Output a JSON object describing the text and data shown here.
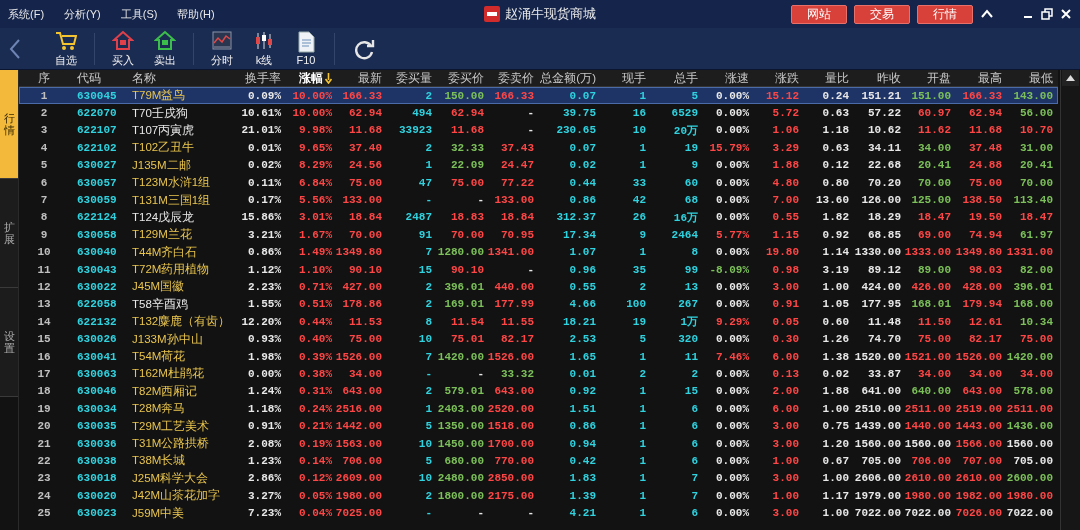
{
  "window": {
    "title": "赵涌牛现货商城",
    "menu": [
      "系统(F)",
      "分析(Y)",
      "工具(S)",
      "帮助(H)"
    ],
    "buttons": [
      "网站",
      "交易",
      "行情"
    ]
  },
  "toolbar": {
    "groups": [
      [
        {
          "kind": "cart",
          "label": "自选"
        }
      ],
      [
        {
          "kind": "buy",
          "label": "买入"
        },
        {
          "kind": "sell",
          "label": "卖出"
        }
      ],
      [
        {
          "kind": "intraday",
          "label": "分时"
        },
        {
          "kind": "kline",
          "label": "k线"
        },
        {
          "kind": "doc",
          "label": "F10"
        }
      ],
      [
        {
          "kind": "refresh"
        }
      ]
    ]
  },
  "side_tabs": [
    {
      "label": "行情",
      "selected": true
    },
    {
      "label": "扩展",
      "selected": false
    },
    {
      "label": "设置",
      "selected": false
    }
  ],
  "table": {
    "columns": [
      {
        "label": "序",
        "sorted": false
      },
      {
        "label": "代码",
        "sorted": false
      },
      {
        "label": "名称",
        "sorted": false
      },
      {
        "label": "换手率",
        "sorted": false
      },
      {
        "label": "涨幅",
        "sorted": true
      },
      {
        "label": "最新",
        "sorted": false
      },
      {
        "label": "委买量",
        "sorted": false
      },
      {
        "label": "委买价",
        "sorted": false
      },
      {
        "label": "委卖价",
        "sorted": false
      },
      {
        "label": "总金额(万)",
        "sorted": false
      },
      {
        "label": "现手",
        "sorted": false
      },
      {
        "label": "总手",
        "sorted": false
      },
      {
        "label": "涨速",
        "sorted": false
      },
      {
        "label": "涨跌",
        "sorted": false
      },
      {
        "label": "量比",
        "sorted": false
      },
      {
        "label": "昨收",
        "sorted": false
      },
      {
        "label": "开盘",
        "sorted": false
      },
      {
        "label": "最高",
        "sorted": false
      },
      {
        "label": "最低",
        "sorted": false
      }
    ],
    "rows": [
      {
        "selected": true,
        "highlight": true,
        "cells": [
          "1",
          "630045",
          "T79M益鸟",
          "0.09%",
          "10.00%",
          "166.33",
          "2",
          "150.00",
          "166.33",
          "0.07",
          "1",
          "5",
          "0.00%",
          "15.12",
          "0.24",
          "151.21",
          "151.00",
          "166.33",
          "143.00"
        ]
      },
      {
        "selected": false,
        "highlight": false,
        "cells": [
          "2",
          "622070",
          "T70壬戌狗",
          "10.61%",
          "10.00%",
          "62.94",
          "494",
          "62.94",
          "-",
          "39.75",
          "16",
          "6529",
          "0.00%",
          "5.72",
          "0.63",
          "57.22",
          "60.97",
          "62.94",
          "56.00"
        ]
      },
      {
        "selected": false,
        "highlight": false,
        "cells": [
          "3",
          "622107",
          "T107丙寅虎",
          "21.01%",
          "9.98%",
          "11.68",
          "33923",
          "11.68",
          "-",
          "230.65",
          "10",
          "20万",
          "0.00%",
          "1.06",
          "1.18",
          "10.62",
          "11.62",
          "11.68",
          "10.70"
        ]
      },
      {
        "selected": false,
        "highlight": true,
        "cells": [
          "4",
          "622102",
          "T102乙丑牛",
          "0.01%",
          "9.65%",
          "37.40",
          "2",
          "32.33",
          "37.43",
          "0.07",
          "1",
          "19",
          "15.79%",
          "3.29",
          "0.63",
          "34.11",
          "34.00",
          "37.48",
          "31.00"
        ]
      },
      {
        "selected": false,
        "highlight": true,
        "cells": [
          "5",
          "630027",
          "J135M二邮",
          "0.02%",
          "8.29%",
          "24.56",
          "1",
          "22.09",
          "24.47",
          "0.02",
          "1",
          "9",
          "0.00%",
          "1.88",
          "0.12",
          "22.68",
          "20.41",
          "24.88",
          "20.41"
        ]
      },
      {
        "selected": false,
        "highlight": true,
        "cells": [
          "6",
          "630057",
          "T123M水浒1组",
          "0.11%",
          "6.84%",
          "75.00",
          "47",
          "75.00",
          "77.22",
          "0.44",
          "33",
          "60",
          "0.00%",
          "4.80",
          "0.80",
          "70.20",
          "70.00",
          "75.00",
          "70.00"
        ]
      },
      {
        "selected": false,
        "highlight": true,
        "cells": [
          "7",
          "630059",
          "T131M三国1组",
          "0.17%",
          "5.56%",
          "133.00",
          "-",
          "-",
          "133.00",
          "0.86",
          "42",
          "68",
          "0.00%",
          "7.00",
          "13.60",
          "126.00",
          "125.00",
          "138.50",
          "113.40"
        ]
      },
      {
        "selected": false,
        "highlight": false,
        "cells": [
          "8",
          "622124",
          "T124戊辰龙",
          "15.86%",
          "3.01%",
          "18.84",
          "2487",
          "18.83",
          "18.84",
          "312.37",
          "26",
          "16万",
          "0.00%",
          "0.55",
          "1.82",
          "18.29",
          "18.47",
          "19.50",
          "18.47"
        ]
      },
      {
        "selected": false,
        "highlight": true,
        "cells": [
          "9",
          "630058",
          "T129M兰花",
          "3.21%",
          "1.67%",
          "70.00",
          "91",
          "70.00",
          "70.95",
          "17.34",
          "9",
          "2464",
          "5.77%",
          "1.15",
          "0.92",
          "68.85",
          "69.00",
          "74.94",
          "61.97"
        ]
      },
      {
        "selected": false,
        "highlight": true,
        "cells": [
          "10",
          "630040",
          "T44M齐白石",
          "0.86%",
          "1.49%",
          "1349.80",
          "7",
          "1280.00",
          "1341.00",
          "1.07",
          "1",
          "8",
          "0.00%",
          "19.80",
          "1.14",
          "1330.00",
          "1333.00",
          "1349.80",
          "1331.00"
        ]
      },
      {
        "selected": false,
        "highlight": true,
        "cells": [
          "11",
          "630043",
          "T72M药用植物",
          "1.12%",
          "1.10%",
          "90.10",
          "15",
          "90.10",
          "-",
          "0.96",
          "35",
          "99",
          "-8.09%",
          "0.98",
          "3.19",
          "89.12",
          "89.00",
          "98.03",
          "82.00"
        ]
      },
      {
        "selected": false,
        "highlight": true,
        "cells": [
          "12",
          "630022",
          "J45M国徽",
          "2.23%",
          "0.71%",
          "427.00",
          "2",
          "396.01",
          "440.00",
          "0.55",
          "2",
          "13",
          "0.00%",
          "3.00",
          "1.00",
          "424.00",
          "426.00",
          "428.00",
          "396.01"
        ]
      },
      {
        "selected": false,
        "highlight": false,
        "cells": [
          "13",
          "622058",
          "T58辛酉鸡",
          "1.55%",
          "0.51%",
          "178.86",
          "2",
          "169.01",
          "177.99",
          "4.66",
          "100",
          "267",
          "0.00%",
          "0.91",
          "1.05",
          "177.95",
          "168.01",
          "179.94",
          "168.00"
        ]
      },
      {
        "selected": false,
        "highlight": true,
        "cells": [
          "14",
          "622132",
          "T132麋鹿（有齿）",
          "12.20%",
          "0.44%",
          "11.53",
          "8",
          "11.54",
          "11.55",
          "18.21",
          "19",
          "1万",
          "9.29%",
          "0.05",
          "0.60",
          "11.48",
          "11.50",
          "12.61",
          "10.34"
        ]
      },
      {
        "selected": false,
        "highlight": true,
        "cells": [
          "15",
          "630026",
          "J133M孙中山",
          "0.93%",
          "0.40%",
          "75.00",
          "10",
          "75.01",
          "82.17",
          "2.53",
          "5",
          "320",
          "0.00%",
          "0.30",
          "1.26",
          "74.70",
          "75.00",
          "82.17",
          "75.00"
        ]
      },
      {
        "selected": false,
        "highlight": true,
        "cells": [
          "16",
          "630041",
          "T54M荷花",
          "1.98%",
          "0.39%",
          "1526.00",
          "7",
          "1420.00",
          "1526.00",
          "1.65",
          "1",
          "11",
          "7.46%",
          "6.00",
          "1.38",
          "1520.00",
          "1521.00",
          "1526.00",
          "1420.00"
        ]
      },
      {
        "selected": false,
        "highlight": true,
        "cells": [
          "17",
          "630063",
          "T162M杜鹃花",
          "0.00%",
          "0.38%",
          "34.00",
          "-",
          "-",
          "33.32",
          "0.01",
          "2",
          "2",
          "0.00%",
          "0.13",
          "0.02",
          "33.87",
          "34.00",
          "34.00",
          "34.00"
        ]
      },
      {
        "selected": false,
        "highlight": true,
        "cells": [
          "18",
          "630046",
          "T82M西厢记",
          "1.24%",
          "0.31%",
          "643.00",
          "2",
          "579.01",
          "643.00",
          "0.92",
          "1",
          "15",
          "0.00%",
          "2.00",
          "1.88",
          "641.00",
          "640.00",
          "643.00",
          "578.00"
        ]
      },
      {
        "selected": false,
        "highlight": true,
        "cells": [
          "19",
          "630034",
          "T28M奔马",
          "1.18%",
          "0.24%",
          "2516.00",
          "1",
          "2403.00",
          "2520.00",
          "1.51",
          "1",
          "6",
          "0.00%",
          "6.00",
          "1.00",
          "2510.00",
          "2511.00",
          "2519.00",
          "2511.00"
        ]
      },
      {
        "selected": false,
        "highlight": true,
        "cells": [
          "20",
          "630035",
          "T29M工艺美术",
          "0.91%",
          "0.21%",
          "1442.00",
          "5",
          "1350.00",
          "1518.00",
          "0.86",
          "1",
          "6",
          "0.00%",
          "3.00",
          "0.75",
          "1439.00",
          "1440.00",
          "1443.00",
          "1436.00"
        ]
      },
      {
        "selected": false,
        "highlight": true,
        "cells": [
          "21",
          "630036",
          "T31M公路拱桥",
          "2.08%",
          "0.19%",
          "1563.00",
          "10",
          "1450.00",
          "1700.00",
          "0.94",
          "1",
          "6",
          "0.00%",
          "3.00",
          "1.20",
          "1560.00",
          "1560.00",
          "1566.00",
          "1560.00"
        ]
      },
      {
        "selected": false,
        "highlight": true,
        "cells": [
          "22",
          "630038",
          "T38M长城",
          "1.23%",
          "0.14%",
          "706.00",
          "5",
          "680.00",
          "770.00",
          "0.42",
          "1",
          "6",
          "0.00%",
          "1.00",
          "0.67",
          "705.00",
          "706.00",
          "707.00",
          "705.00"
        ]
      },
      {
        "selected": false,
        "highlight": true,
        "cells": [
          "23",
          "630018",
          "J25M科学大会",
          "2.86%",
          "0.12%",
          "2609.00",
          "10",
          "2480.00",
          "2850.00",
          "1.83",
          "1",
          "7",
          "0.00%",
          "3.00",
          "1.00",
          "2606.00",
          "2610.00",
          "2610.00",
          "2600.00"
        ]
      },
      {
        "selected": false,
        "highlight": true,
        "cells": [
          "24",
          "630020",
          "J42M山茶花加字",
          "3.27%",
          "0.05%",
          "1980.00",
          "2",
          "1800.00",
          "2175.00",
          "1.39",
          "1",
          "7",
          "0.00%",
          "1.00",
          "1.17",
          "1979.00",
          "1980.00",
          "1982.00",
          "1980.00"
        ]
      },
      {
        "selected": false,
        "highlight": true,
        "cells": [
          "25",
          "630023",
          "J59M中美",
          "7.23%",
          "0.04%",
          "7025.00",
          "-",
          "-",
          "-",
          "4.21",
          "1",
          "6",
          "0.00%",
          "3.00",
          "1.00",
          "7022.00",
          "7022.00",
          "7026.00",
          "7022.00"
        ]
      }
    ]
  }
}
